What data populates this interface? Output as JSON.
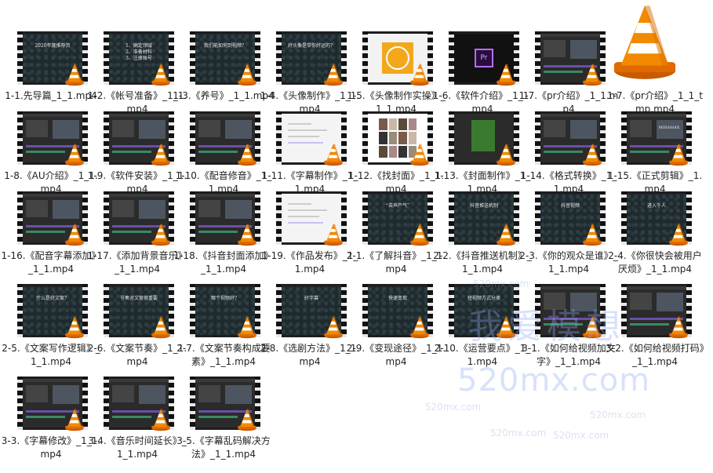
{
  "files": [
    {
      "name": "1-1.先导篇_1_1.mp4",
      "thumb": "dark",
      "text": "2020年度推荐页"
    },
    {
      "name": "1-2.《帐号准备》_1_1.mp4",
      "thumb": "dark",
      "text": "1、确定领域\n2、准备材料\n3、注册账号"
    },
    {
      "name": "1-3.《养号》_1_1.mp4",
      "thumb": "dark",
      "text": "我们能如何到视频？"
    },
    {
      "name": "1-4.《头像制作》_1_1.mp4",
      "thumb": "dark",
      "text": "好头像是带你好运的？"
    },
    {
      "name": "1-5.《头像制作实操》_1_1.mp4",
      "thumb": "logo",
      "text": ""
    },
    {
      "name": "1-6.《软件介绍》_1_1.mp4",
      "thumb": "pr",
      "text": "Pr"
    },
    {
      "name": "1-7.《pr介绍》_1_1.mp4",
      "thumb": "ui",
      "text": ""
    },
    {
      "name": "1-7.《pr介绍》_1_1_tmp.mp4",
      "thumb": "vlc",
      "text": ""
    },
    {
      "name": "1-8.《AU介绍》_1_1.mp4",
      "thumb": "ui",
      "text": ""
    },
    {
      "name": "1-9.《软件安装》_1_1.mp4",
      "thumb": "ui",
      "text": ""
    },
    {
      "name": "1-10.《配音修音》_1_1.mp4",
      "thumb": "ui",
      "text": ""
    },
    {
      "name": "1-11.《字幕制作》_1_1.mp4",
      "thumb": "light",
      "text": ""
    },
    {
      "name": "1-12.《找封面》_1_1.mp4",
      "thumb": "photos",
      "text": ""
    },
    {
      "name": "1-13.《封面制作》_1_1.mp4",
      "thumb": "green",
      "text": ""
    },
    {
      "name": "1-14.《格式转换》_1_1.mp4",
      "thumb": "ui",
      "text": ""
    },
    {
      "name": "1-15.《正式剪辑》_1.mp4",
      "thumb": "ui",
      "text": "MIRAMAX"
    },
    {
      "name": "1-16.《配音字幕添加》_1_1.mp4",
      "thumb": "ui",
      "text": ""
    },
    {
      "name": "1-17.《添加背景音乐》_1_1.mp4",
      "thumb": "ui",
      "text": ""
    },
    {
      "name": "1-18.《抖音封面添加》_1_1.mp4",
      "thumb": "ui",
      "text": ""
    },
    {
      "name": "1-19.《作品发布》_1_1.mp4",
      "thumb": "light",
      "text": ""
    },
    {
      "name": "2-1.《了解抖音》_1_1.mp4",
      "thumb": "dark",
      "text": "“去声产气”"
    },
    {
      "name": "2-2.《抖音推送机制》_1_1.mp4",
      "thumb": "dark",
      "text": "抖音推送机制"
    },
    {
      "name": "2-3.《你的观众是谁》_1_1.mp4",
      "thumb": "dark",
      "text": "抖音视频"
    },
    {
      "name": "2-4.《你很快会被用户厌烦》_1_1.mp4",
      "thumb": "dark",
      "text": "进入千人"
    },
    {
      "name": "2-5.《文案写作逻辑》_1_1.mp4",
      "thumb": "dark",
      "text": "什么是好文案？"
    },
    {
      "name": "2-6.《文案节奏》_1_1.mp4",
      "thumb": "dark",
      "text": "节奏对文案很重要"
    },
    {
      "name": "2-7.《文案节奏构成要素》_1_1.mp4",
      "thumb": "dark",
      "text": "哪个视频好？"
    },
    {
      "name": "2-8.《选剧方法》_1_1.mp4",
      "thumb": "dark",
      "text": "好字幕"
    },
    {
      "name": "2-9.《变现途径》_1_1.mp4",
      "thumb": "dark",
      "text": "快速变现"
    },
    {
      "name": "2-10.《运营要点》_1_1.mp4",
      "thumb": "dark",
      "text": "短视频方式分类"
    },
    {
      "name": "3-1.《如何给视频加文字》_1_1.mp4",
      "thumb": "ui",
      "text": ""
    },
    {
      "name": "3-2.《如何给视频打码》_1_1.mp4",
      "thumb": "ui",
      "text": ""
    },
    {
      "name": "3-3.《字幕修改》_1_1.mp4",
      "thumb": "ui",
      "text": ""
    },
    {
      "name": "3-4.《音乐时间延长》_1_1.mp4",
      "thumb": "ui",
      "text": ""
    },
    {
      "name": "3-5.《字幕乱码解决方法》_1_1.mp4",
      "thumb": "ui",
      "text": ""
    }
  ],
  "watermark": {
    "main": "我爱模想",
    "domain": "520mx.com",
    "small": [
      "520mx.com",
      "520mx.com",
      "520mx.com",
      "520mx.com",
      "520mx.com"
    ]
  }
}
